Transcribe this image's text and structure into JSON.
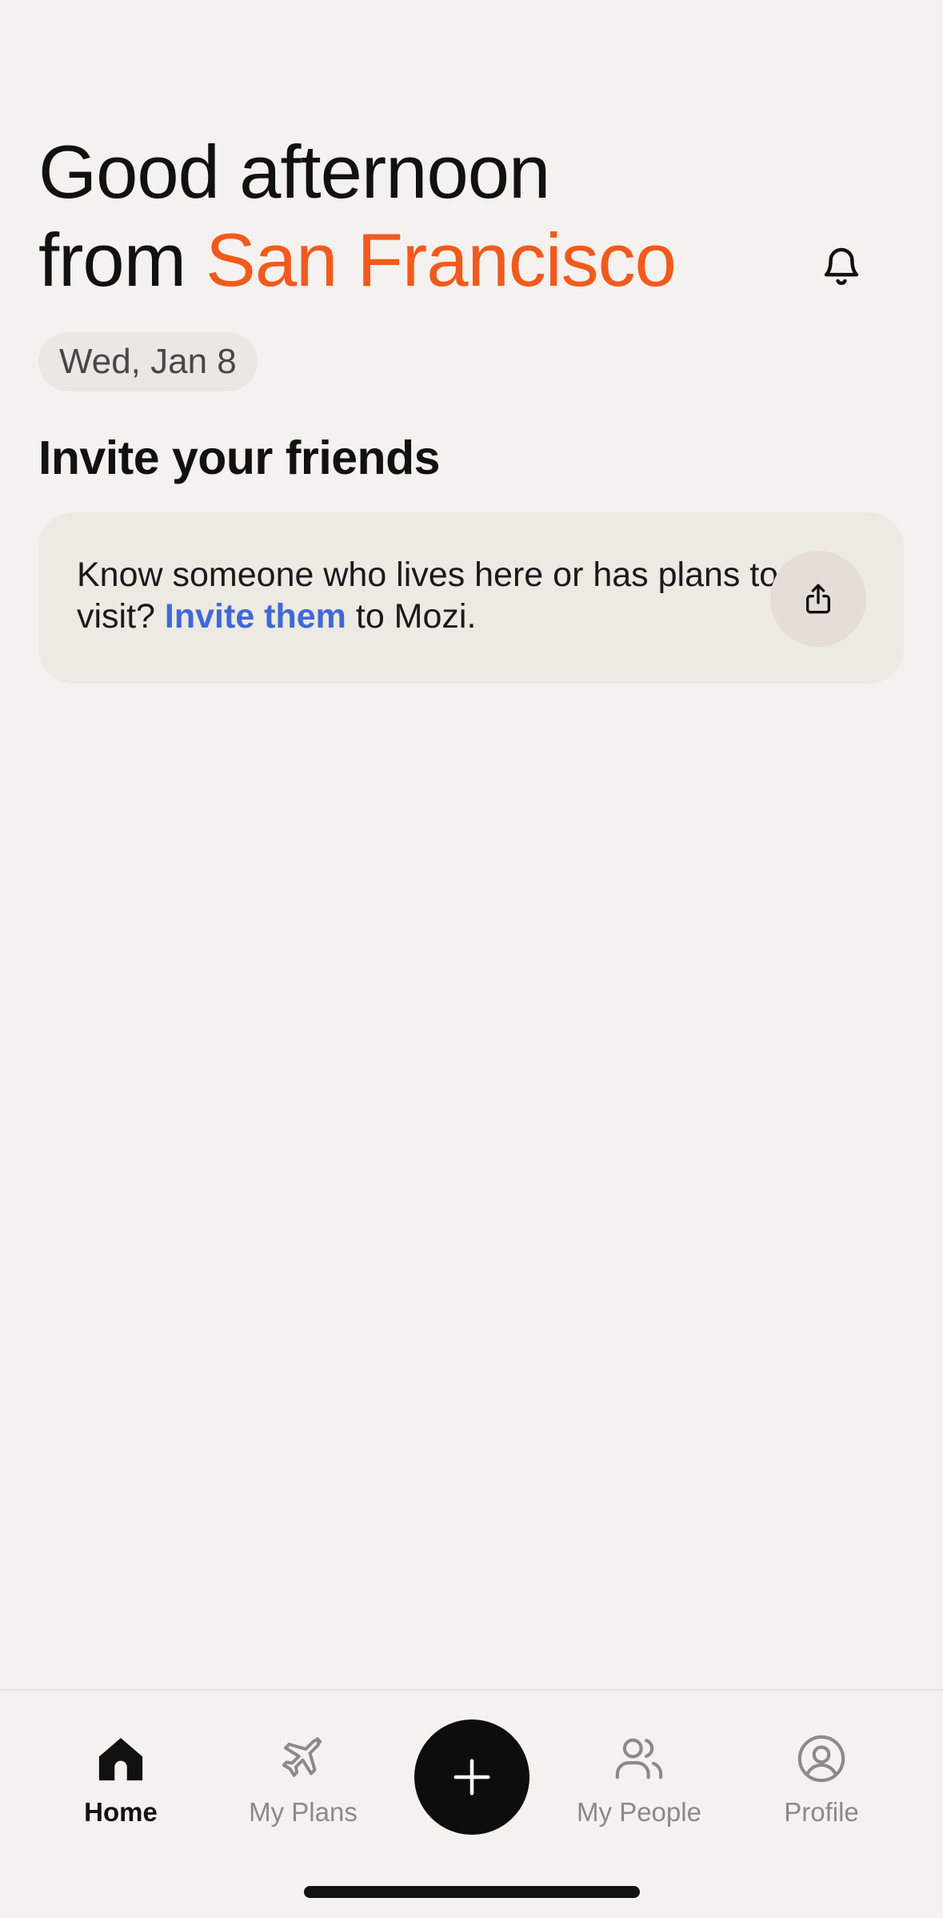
{
  "header": {
    "greeting_line1": "Good afternoon",
    "greeting_from": "from ",
    "city": "San Francisco",
    "date": "Wed, Jan 8",
    "bell_icon": "bell-icon"
  },
  "invite": {
    "section_title": "Invite your friends",
    "text_before": "Know someone who lives here or has plans to visit? ",
    "link_text": "Invite them",
    "text_after": " to Mozi.",
    "share_icon": "share-icon"
  },
  "tabbar": {
    "tabs": [
      {
        "label": "Home",
        "icon": "home-icon",
        "active": true
      },
      {
        "label": "My Plans",
        "icon": "airplane-icon",
        "active": false
      },
      {
        "label": "My People",
        "icon": "people-icon",
        "active": false
      },
      {
        "label": "Profile",
        "icon": "profile-icon",
        "active": false
      }
    ],
    "add_icon": "plus-icon"
  },
  "colors": {
    "background": "#f4f1ee",
    "accent_city": "#f25a1c",
    "link": "#3f69d9",
    "card": "#ede9e3",
    "fab": "#0d0d0d"
  }
}
